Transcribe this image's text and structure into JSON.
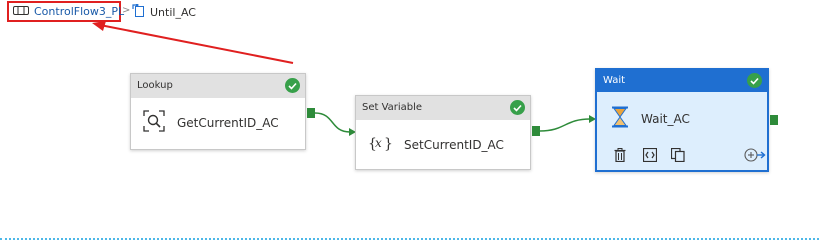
{
  "breadcrumb": {
    "pipeline_label": "ControlFlow3_PL",
    "separator": ">",
    "until_label": "Until_AC"
  },
  "activities": {
    "lookup": {
      "type_label": "Lookup",
      "name": "GetCurrentID_AC"
    },
    "set_variable": {
      "type_label": "Set Variable",
      "name": "SetCurrentID_AC"
    },
    "wait": {
      "type_label": "Wait",
      "name": "Wait_AC"
    }
  },
  "icons": {
    "pipeline": "pipeline-icon",
    "until": "until-loop-icon",
    "lookup": "lookup-icon",
    "set_variable": "set-variable-icon",
    "wait": "hourglass-icon",
    "success": "checkmark-icon",
    "delete": "trash-icon",
    "view_source": "code-icon",
    "copy": "copy-icon",
    "add_output": "add-output-icon"
  },
  "colors": {
    "accent": "#1f6fd1",
    "success": "#37a04a",
    "connector": "#2e8b3a",
    "highlight": "#e02020",
    "header_gray": "#e1e1e1",
    "selected_bg": "#ddeefd"
  }
}
